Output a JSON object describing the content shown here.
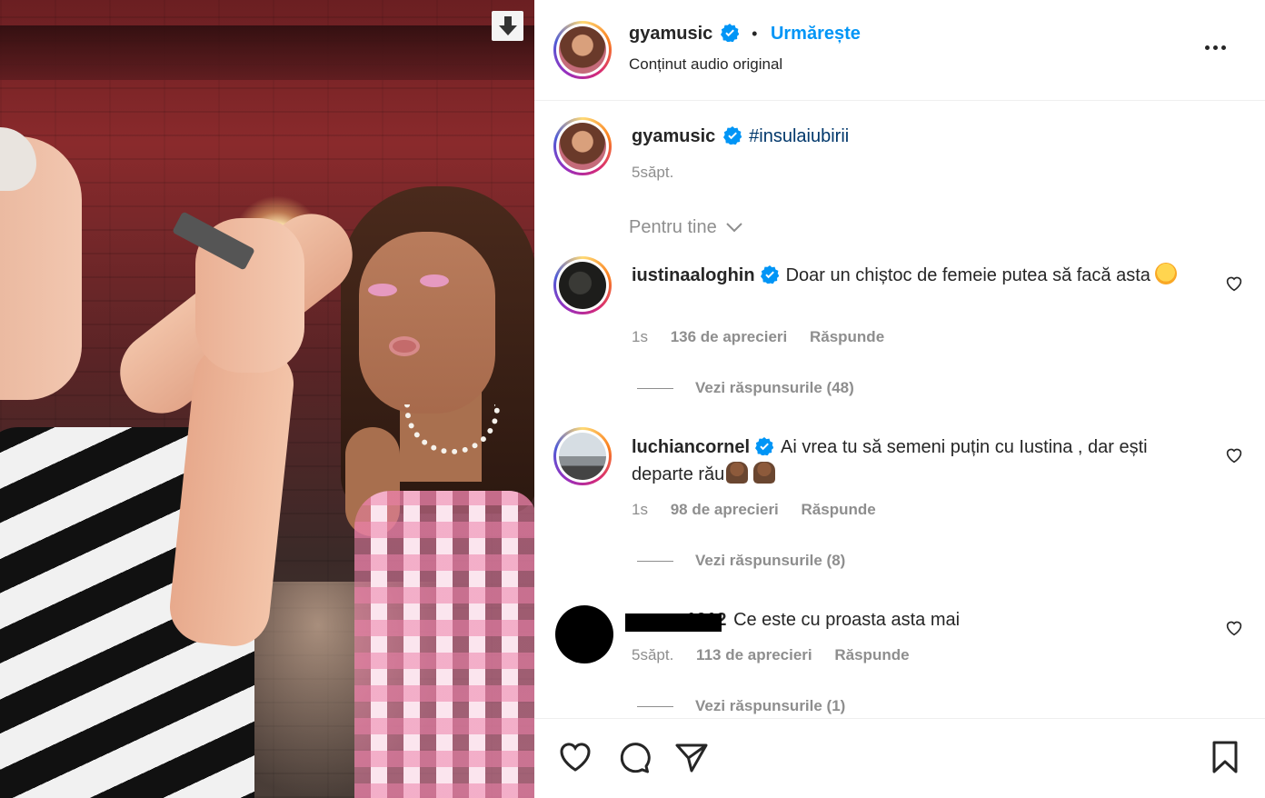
{
  "post": {
    "author": "gyamusic",
    "follow_label": "Urmărește",
    "dot": "•",
    "audio_label": "Conținut audio original",
    "caption_hashtag": "#insulaiubirii",
    "caption_time": "5săpt."
  },
  "sort": {
    "label": "Pentru tine"
  },
  "comments": [
    {
      "username": "iustinaaloghin",
      "text": "Doar un chiștoc de femeie putea să facă asta",
      "time": "1s",
      "likes": "136 de aprecieri",
      "reply_label": "Răspunde",
      "replies_label": "Vezi răspunsurile (48)"
    },
    {
      "username": "luchiancornel",
      "text": "Ai vrea tu să semeni puțin cu Iustina , dar ești departe rău",
      "time": "1s",
      "likes": "98 de aprecieri",
      "reply_label": "Răspunde",
      "replies_label": "Vezi răspunsurile (8)"
    },
    {
      "username_fragment": "1012",
      "text": "Ce este cu proasta asta mai",
      "time": "5săpt.",
      "likes": "113 de aprecieri",
      "reply_label": "Răspunde",
      "replies_label": "Vezi răspunsurile (1)"
    }
  ],
  "colors": {
    "accent": "#0095f6",
    "verified": "#0095f6",
    "muted": "#8e8e8e",
    "text": "#262626"
  },
  "icons": {
    "download": "download-icon",
    "more": "more-icon",
    "verified": "verified-badge-icon",
    "like": "heart-icon",
    "comment": "comment-icon",
    "share": "send-icon",
    "save": "bookmark-icon",
    "sort": "chevron-down-icon"
  }
}
